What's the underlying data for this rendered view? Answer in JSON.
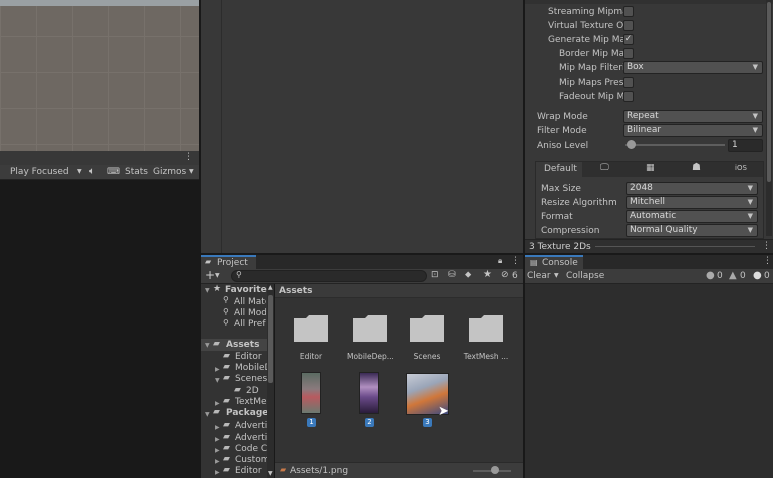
{
  "game_view": {
    "toolbar": {
      "play_focused": "Play Focused",
      "stats": "Stats",
      "gizmos": "Gizmos"
    }
  },
  "inspector": {
    "rows": [
      {
        "label": "Streaming Mipmap",
        "type": "check",
        "checked": false
      },
      {
        "label": "Virtual Texture Onl",
        "type": "check",
        "checked": false
      },
      {
        "label": "Generate Mip Map",
        "type": "check",
        "checked": true
      },
      {
        "label": "Border Mip Map",
        "type": "check",
        "checked": false
      },
      {
        "label": "Mip Map Filterin",
        "type": "dropdown",
        "value": "Box"
      },
      {
        "label": "Mip Maps Prese",
        "type": "check",
        "checked": false
      },
      {
        "label": "Fadeout Mip Ma",
        "type": "check",
        "checked": false
      }
    ],
    "wrap_mode": {
      "label": "Wrap Mode",
      "value": "Repeat"
    },
    "filter_mode": {
      "label": "Filter Mode",
      "value": "Bilinear"
    },
    "aniso_level": {
      "label": "Aniso Level",
      "value": "1",
      "fraction": 0.0
    },
    "platform_tabs": {
      "default": "Default",
      "ios": "iOS"
    },
    "platform_rows": [
      {
        "label": "Max Size",
        "value": "2048"
      },
      {
        "label": "Resize Algorithm",
        "value": "Mitchell"
      },
      {
        "label": "Format",
        "value": "Automatic"
      },
      {
        "label": "Compression",
        "value": "Normal Quality"
      }
    ],
    "footer": "3 Texture 2Ds"
  },
  "project": {
    "tab": "Project",
    "count_badge": "6",
    "favorites": {
      "title": "Favorites",
      "items": [
        "All Mate",
        "All Mod",
        "All Prefa"
      ]
    },
    "assets": {
      "title": "Assets",
      "items": [
        "Editor",
        "MobileD",
        "Scenes",
        "2D",
        "TextMe"
      ]
    },
    "packages": {
      "title": "Packages",
      "items": [
        "Advertis",
        "Advertis",
        "Code C",
        "Custom",
        "Editor C"
      ]
    },
    "breadcrumb": "Assets",
    "folders": [
      "Editor",
      "MobileDep...",
      "Scenes",
      "TextMesh ..."
    ],
    "images": [
      {
        "label": "1"
      },
      {
        "label": "2"
      },
      {
        "label": "3"
      }
    ],
    "status_path": "Assets/1.png"
  },
  "console": {
    "tab": "Console",
    "clear": "Clear",
    "collapse": "Collapse",
    "counts": {
      "info": "0",
      "warn": "0",
      "error": "0"
    }
  }
}
